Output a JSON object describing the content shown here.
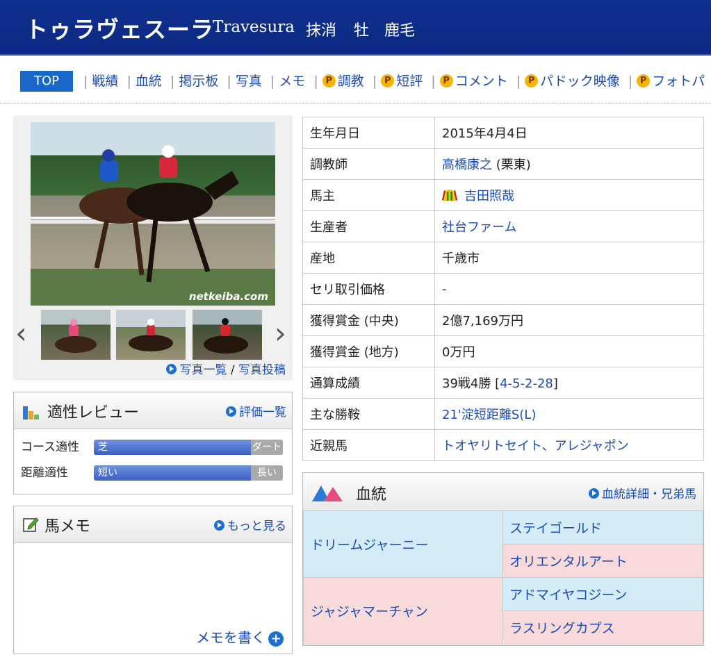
{
  "header": {
    "jp_name": "トゥラヴェスーラ",
    "en_name": "Travesura",
    "status": "抹消",
    "sex": "牡",
    "coat_color": "鹿毛"
  },
  "nav": {
    "top": "TOP",
    "items": [
      {
        "label": "戦績",
        "premium": false
      },
      {
        "label": "血統",
        "premium": false
      },
      {
        "label": "掲示板",
        "premium": false
      },
      {
        "label": "写真",
        "premium": false
      },
      {
        "label": "メモ",
        "premium": false
      },
      {
        "label": "調教",
        "premium": true
      },
      {
        "label": "短評",
        "premium": true
      },
      {
        "label": "コメント",
        "premium": true
      },
      {
        "label": "パドック映像",
        "premium": true
      },
      {
        "label": "フォトパ",
        "premium": true
      }
    ],
    "premium_badge": "P"
  },
  "photo": {
    "watermark": "netkeiba.com",
    "links": {
      "list": "写真一覧",
      "separator": "/",
      "post": "写真投稿"
    }
  },
  "aptitude": {
    "title": "適性レビュー",
    "link": "評価一覧",
    "rows": [
      {
        "label": "コース適性",
        "left": "芝",
        "right": "ダート"
      },
      {
        "label": "距離適性",
        "left": "短い",
        "right": "長い"
      }
    ]
  },
  "memo": {
    "title": "馬メモ",
    "link": "もっと見る",
    "write": "メモを書く"
  },
  "profile": {
    "rows": [
      {
        "label": "生年月日",
        "value": "2015年4月4日"
      },
      {
        "label": "調教師",
        "link": "高橋康之",
        "suffix": " (栗東)"
      },
      {
        "label": "馬主",
        "link": "吉田照哉"
      },
      {
        "label": "生産者",
        "link": "社台ファーム"
      },
      {
        "label": "産地",
        "value": "千歳市"
      },
      {
        "label": "セリ取引価格",
        "value": "-"
      },
      {
        "label": "獲得賞金 (中央)",
        "value": "2億7,169万円"
      },
      {
        "label": "獲得賞金 (地方)",
        "value": "0万円"
      },
      {
        "label": "通算成績",
        "value": "39戦4勝 [",
        "link": "4-5-2-28",
        "suffix": "]"
      },
      {
        "label": "主な勝鞍",
        "link": "21'淀短距離S(L)"
      },
      {
        "label": "近親馬",
        "link": "トオヤリトセイト、アレジャポン"
      }
    ]
  },
  "pedigree": {
    "title": "血統",
    "link": "血統詳細・兄弟馬",
    "sire": "ドリームジャーニー",
    "sire_sire": "ステイゴールド",
    "sire_dam": "オリエンタルアート",
    "dam": "ジャジャマーチャン",
    "dam_sire": "アドマイヤコジーン",
    "dam_dam": "ラスリングカプス"
  },
  "colors": {
    "header_bg": "#0b2a82",
    "link": "#1a4cb8",
    "top_tab": "#1768c8",
    "male_bg": "#d4ecf8",
    "female_bg": "#f8dada"
  }
}
